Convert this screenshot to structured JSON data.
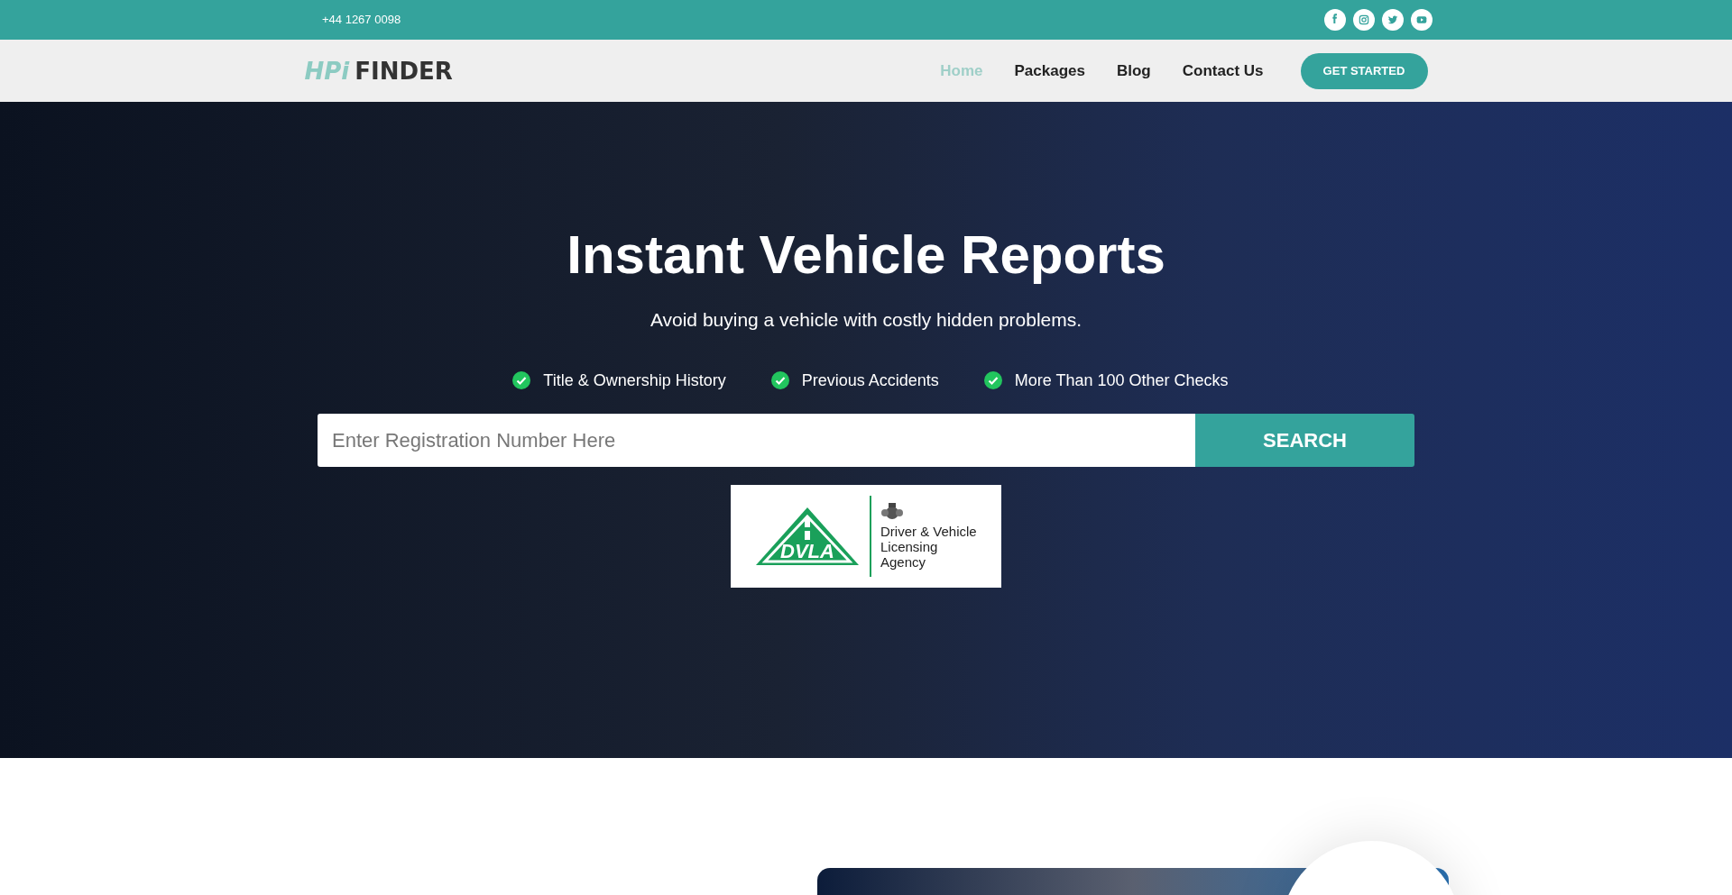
{
  "top_bar": {
    "phone": "+44 1267 0098",
    "social": [
      {
        "kind": "facebook"
      },
      {
        "kind": "instagram"
      },
      {
        "kind": "twitter"
      },
      {
        "kind": "youtube"
      }
    ]
  },
  "header": {
    "logo": {
      "prefix": "HPi",
      "name": "FINDER"
    },
    "nav": [
      {
        "label": "Home",
        "selected": true
      },
      {
        "label": "Packages",
        "selected": false
      },
      {
        "label": "Blog",
        "selected": false
      },
      {
        "label": "Contact Us",
        "selected": false
      }
    ],
    "cta": "GET STARTED"
  },
  "hero": {
    "title": "Instant Vehicle Reports",
    "subtitle": "Avoid buying a vehicle with costly hidden problems.",
    "checks": [
      "Title & Ownership History",
      "Previous Accidents",
      "More Than 100 Other Checks"
    ],
    "search": {
      "placeholder": "Enter Registration Number Here",
      "button": "SEARCH"
    },
    "badge": {
      "mark": "DVLA",
      "lines": [
        "Driver & Vehicle",
        "Licensing",
        "Agency"
      ]
    }
  }
}
